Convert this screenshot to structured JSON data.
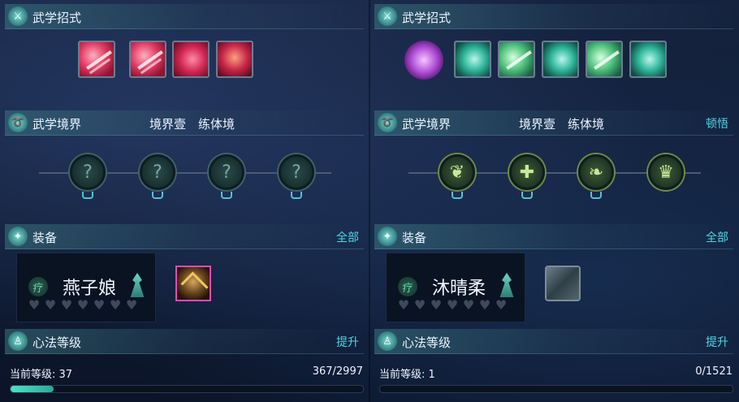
{
  "left": {
    "martial_moves": {
      "title": "武学招式"
    },
    "realm": {
      "title": "武学境界",
      "stage": "境界壹",
      "stage_name": "练体境"
    },
    "equipment": {
      "title": "装备",
      "all_label": "全部"
    },
    "character": {
      "role_glyph": "疗",
      "name": "燕子娘",
      "hearts_total": 7
    },
    "mind_level": {
      "title": "心法等级",
      "upgrade_label": "提升",
      "level_text": "当前等级: 37",
      "progress_text": "367/2997",
      "progress_fraction": 0.1225
    }
  },
  "right": {
    "martial_moves": {
      "title": "武学招式"
    },
    "realm": {
      "title": "武学境界",
      "stage": "境界壹",
      "stage_name": "练体境",
      "comprehend_label": "顿悟"
    },
    "equipment": {
      "title": "装备",
      "all_label": "全部"
    },
    "character": {
      "role_glyph": "疗",
      "name": "沐晴柔",
      "hearts_total": 7
    },
    "mind_level": {
      "title": "心法等级",
      "upgrade_label": "提升",
      "level_text": "当前等级: 1",
      "progress_text": "0/1521",
      "progress_fraction": 0.0
    }
  },
  "icons": {
    "section": "sword-icon",
    "realm": "swirl-icon",
    "equip": "armor-icon",
    "mind": "figure-icon",
    "node_locked": "?",
    "heart": "♥"
  },
  "colors": {
    "accent_link": "#4fd6e6",
    "progress": "#4fe0c6"
  }
}
